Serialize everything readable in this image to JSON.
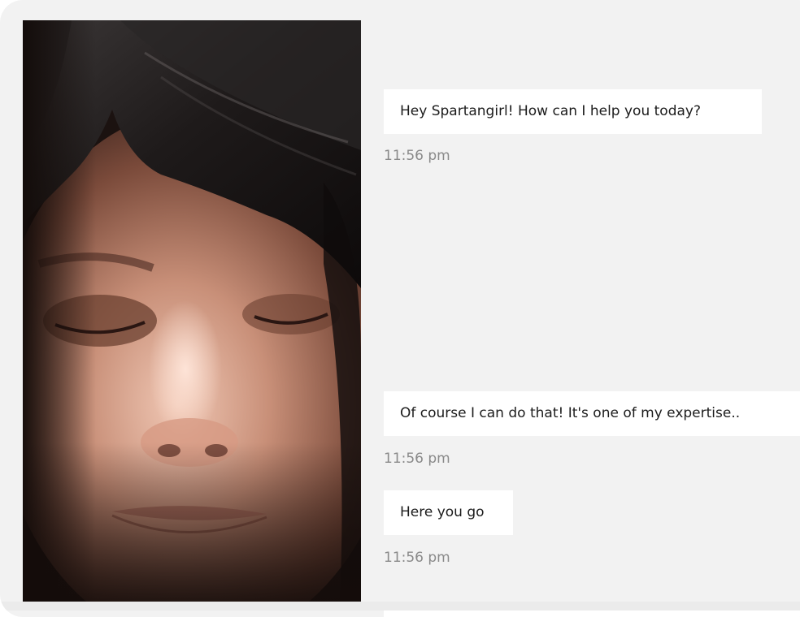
{
  "portrait": {
    "alt_subject": "woman-with-closed-eyes-portrait"
  },
  "messages": [
    {
      "text": "Hey Spartangirl! How can I help you today?",
      "time": "11:56 pm"
    },
    {
      "text": "Of course I can do that! It's one of my expertise..",
      "time": "11:56 pm"
    },
    {
      "text": "Here you go",
      "time": "11:56 pm"
    }
  ],
  "colors": {
    "background": "#f2f2f2",
    "bubble": "#ffffff",
    "bubble_text": "#1c1c1c",
    "timestamp": "#8a8a8a"
  }
}
